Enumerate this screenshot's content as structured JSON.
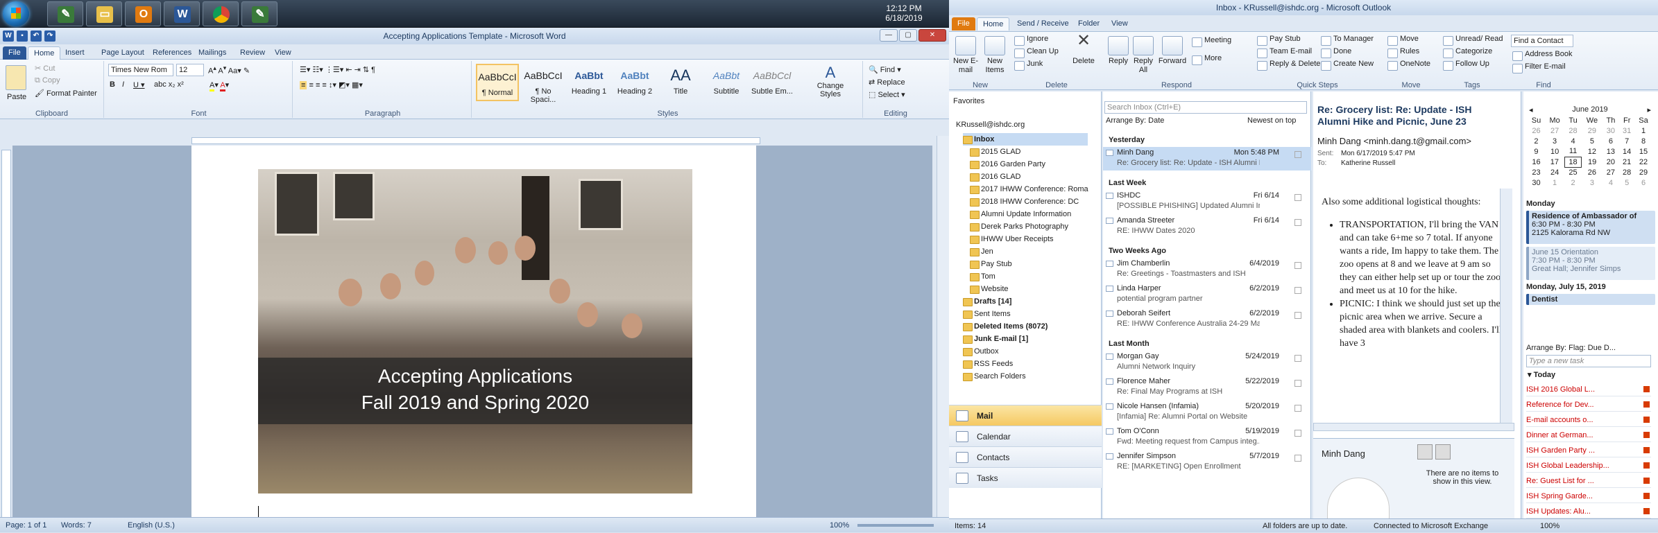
{
  "taskbar": {
    "time": "12:12 PM",
    "date": "6/18/2019"
  },
  "word": {
    "title": "Accepting Applications Template - Microsoft Word",
    "tabs": [
      "File",
      "Home",
      "Insert",
      "Page Layout",
      "References",
      "Mailings",
      "Review",
      "View"
    ],
    "clipboard": {
      "paste": "Paste",
      "cut": "Cut",
      "copy": "Copy",
      "format_painter": "Format Painter",
      "label": "Clipboard"
    },
    "font": {
      "name": "Times New Rom",
      "size": "12",
      "label": "Font"
    },
    "paragraph": {
      "label": "Paragraph"
    },
    "styles": {
      "items": [
        {
          "sample": "AaBbCcI",
          "name": "¶ Normal"
        },
        {
          "sample": "AaBbCcI",
          "name": "¶ No Spaci..."
        },
        {
          "sample": "AaBbt",
          "name": "Heading 1"
        },
        {
          "sample": "AaBbt",
          "name": "Heading 2"
        },
        {
          "sample": "AA",
          "name": "Title"
        },
        {
          "sample": "AaBbt",
          "name": "Subtitle"
        },
        {
          "sample": "AaBbCcl",
          "name": "Subtle Em..."
        }
      ],
      "change": "Change Styles",
      "label": "Styles"
    },
    "editing": {
      "find": "Find",
      "replace": "Replace",
      "select": "Select",
      "label": "Editing"
    },
    "document": {
      "banner_line1": "Accepting Applications",
      "banner_line2": "Fall 2019 and Spring 2020"
    },
    "status": {
      "page": "Page: 1 of 1",
      "words": "Words: 7",
      "language": "English (U.S.)",
      "zoom": "100%"
    }
  },
  "outlook": {
    "title": "Inbox - KRussell@ishdc.org - Microsoft Outlook",
    "tabs": [
      "File",
      "Home",
      "Send / Receive",
      "Folder",
      "View"
    ],
    "ribbon": {
      "new_email": "New E-mail",
      "new_items": "New Items",
      "new_label": "New",
      "ignore": "Ignore",
      "clean_up": "Clean Up",
      "junk": "Junk",
      "delete": "Delete",
      "delete_label": "Delete",
      "reply": "Reply",
      "reply_all": "Reply All",
      "forward": "Forward",
      "meeting": "Meeting",
      "more": "More",
      "respond_label": "Respond",
      "quick_steps": [
        "Pay Stub",
        "Team E-mail",
        "Reply & Delete",
        "To Manager",
        "Done",
        "Create New"
      ],
      "quick_label": "Quick Steps",
      "move": "Move",
      "rules": "Rules",
      "onenote": "OneNote",
      "move_label": "Move",
      "unread": "Unread/ Read",
      "categorize": "Categorize",
      "follow_up": "Follow Up",
      "tags_label": "Tags",
      "find_contact": "Find a Contact",
      "address_book": "Address Book",
      "filter_email": "Filter E-mail",
      "find_label": "Find"
    },
    "nav": {
      "favorites": "Favorites",
      "account": "KRussell@ishdc.org",
      "folders": [
        "Inbox",
        "2015 GLAD",
        "2016 Garden Party",
        "2016 GLAD",
        "2017 IHWW Conference: Roma",
        "2018 IHWW Conference: DC",
        "Alumni Update Information",
        "Derek Parks Photography",
        "IHWW Uber Receipts",
        "Jen",
        "Pay Stub",
        "Tom",
        "Website",
        "Drafts [14]",
        "Sent Items",
        "Deleted Items (8072)",
        "Junk E-mail [1]",
        "Outbox",
        "RSS Feeds",
        "Search Folders"
      ],
      "buttons": [
        "Mail",
        "Calendar",
        "Contacts",
        "Tasks"
      ]
    },
    "list": {
      "search": "Search Inbox (Ctrl+E)",
      "arrange": "Arrange By: Date",
      "order": "Newest on top",
      "groups": [
        {
          "name": "Yesterday",
          "items": [
            {
              "from": "Minh Dang",
              "date": "Mon 5:48 PM",
              "subject": "Re: Grocery list: Re: Update - ISH Alumni Hike ..."
            }
          ]
        },
        {
          "name": "Last Week",
          "items": [
            {
              "from": "ISHDC",
              "date": "Fri 6/14",
              "subject": "[POSSIBLE PHISHING] Updated Alumni Inform..."
            },
            {
              "from": "Amanda Streeter",
              "date": "Fri 6/14",
              "subject": "RE: IHWW Dates 2020"
            }
          ]
        },
        {
          "name": "Two Weeks Ago",
          "items": [
            {
              "from": "Jim Chamberlin",
              "date": "6/4/2019",
              "subject": "Re: Greetings - Toastmasters and ISH"
            },
            {
              "from": "Linda Harper",
              "date": "6/2/2019",
              "subject": "potential program partner"
            },
            {
              "from": "Deborah Seifert",
              "date": "6/2/2019",
              "subject": "RE: IHWW Conference Australia 24-29 May 2020"
            }
          ]
        },
        {
          "name": "Last Month",
          "items": [
            {
              "from": "Morgan Gay",
              "date": "5/24/2019",
              "subject": "Alumni Network Inquiry"
            },
            {
              "from": "Florence Maher",
              "date": "5/22/2019",
              "subject": "Re: Final May Programs at ISH"
            },
            {
              "from": "Nicole Hansen (Infamia)",
              "date": "5/20/2019",
              "subject": "[Infamia] Re: Alumni Portal on Website"
            },
            {
              "from": "Tom O'Conn",
              "date": "5/19/2019",
              "subject": "Fwd: Meeting request from Campus integ..."
            },
            {
              "from": "Jennifer Simpson",
              "date": "5/7/2019",
              "subject": "RE: [MARKETING] Open Enrollment"
            }
          ]
        }
      ]
    },
    "reading": {
      "subject": "Re: Grocery list: Re: Update - ISH Alumni Hike and Picnic, June 23",
      "sender": "Minh Dang <minh.dang.t@gmail.com>",
      "sent_label": "Sent:",
      "sent": "Mon 6/17/2019 5:47 PM",
      "to_label": "To:",
      "to": "Katherine Russell",
      "p1": "Also some additional logistical thoughts:",
      "b1": "TRANSPORTATION, I'll bring the VAN and can take 6+me so 7 total.  If anyone wants a ride, Im happy to take them.  The zoo opens at 8 and we leave at 9 am so they can either help set up or tour the zoo and meet us at 10 for the hike.",
      "b2": "PICNIC: I think we should just set up the picnic area when we arrive.  Secure a shaded area with blankets and coolers.  I'll have 3",
      "people_name": "Minh Dang",
      "people_msg": "There are no items to show in this view."
    },
    "todo": {
      "month": "June 2019",
      "days": [
        "Su",
        "Mo",
        "Tu",
        "We",
        "Th",
        "Fr",
        "Sa"
      ],
      "weeks": [
        [
          "26",
          "27",
          "28",
          "29",
          "30",
          "31",
          "1"
        ],
        [
          "2",
          "3",
          "4",
          "5",
          "6",
          "7",
          "8"
        ],
        [
          "9",
          "10",
          "11",
          "12",
          "13",
          "14",
          "15"
        ],
        [
          "16",
          "17",
          "18",
          "19",
          "20",
          "21",
          "22"
        ],
        [
          "23",
          "24",
          "25",
          "26",
          "27",
          "28",
          "29"
        ],
        [
          "30",
          "1",
          "2",
          "3",
          "4",
          "5",
          "6"
        ]
      ],
      "day1": "Monday",
      "appt1_title": "Residence of Ambassador of",
      "appt1_time": "6:30 PM - 8:30 PM",
      "appt1_place": "2125 Kalorama Rd NW",
      "appt2_title": "June 15 Orientation",
      "appt2_time": "7:30 PM - 8:30 PM",
      "appt2_place": "Great Hall; Jennifer Simps",
      "day2": "Monday, July 15, 2019",
      "appt3": "Dentist",
      "arrange": "Arrange By: Flag: Due D...",
      "new_task": "Type a new task",
      "today": "Today",
      "tasks": [
        "ISH 2016 Global L...",
        "Reference for Dev...",
        "E-mail accounts o...",
        "Dinner at German...",
        "ISH Garden Party ...",
        "ISH Global Leadership...",
        "Re: Guest List for ...",
        "ISH Spring Garde...",
        "ISH Updates: Alu..."
      ]
    },
    "status": {
      "items": "Items: 14",
      "sync": "All folders are up to date.",
      "exchange": "Connected to Microsoft Exchange",
      "zoom": "100%"
    }
  }
}
